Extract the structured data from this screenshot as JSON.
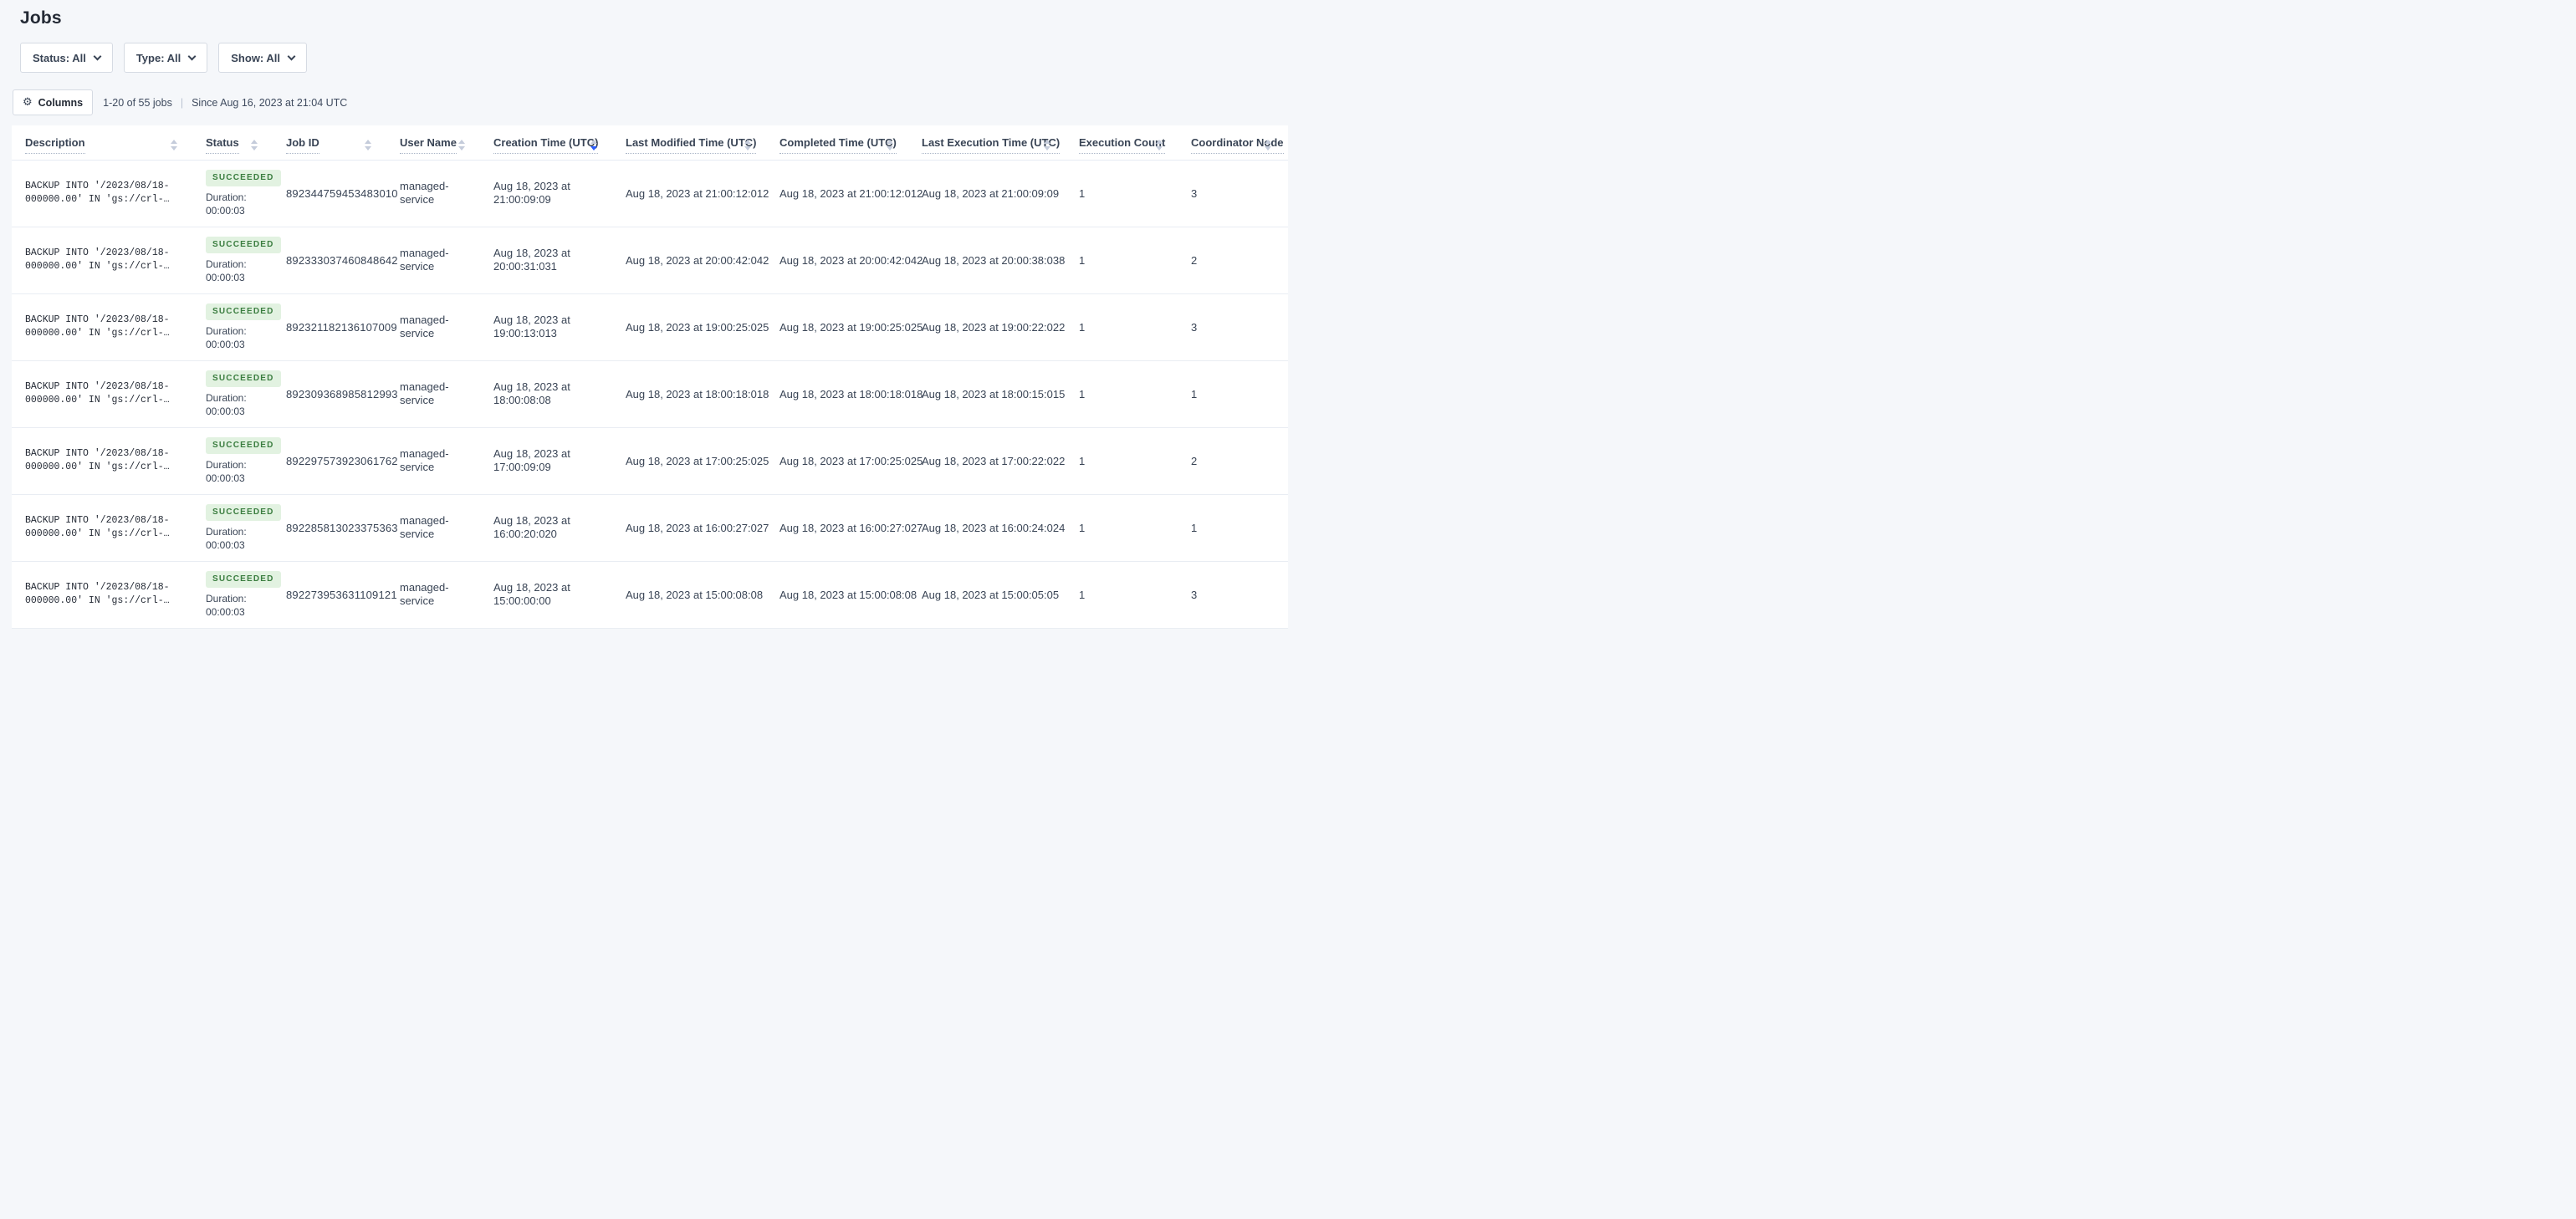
{
  "page": {
    "title": "Jobs"
  },
  "filters": [
    {
      "label": "Status: All"
    },
    {
      "label": "Type: All"
    },
    {
      "label": "Show: All"
    }
  ],
  "toolbar": {
    "columns_button": "Columns",
    "results_count": "1-20 of 55 jobs",
    "separator": "|",
    "since": "Since Aug 16, 2023 at 21:04 UTC"
  },
  "table": {
    "sort": {
      "column": "Creation Time (UTC)",
      "direction": "desc"
    },
    "columns": [
      {
        "label": "Description"
      },
      {
        "label": "Status"
      },
      {
        "label": "Job ID"
      },
      {
        "label": "User Name"
      },
      {
        "label": "Creation Time (UTC)"
      },
      {
        "label": "Last Modified Time (UTC)"
      },
      {
        "label": "Completed Time (UTC)"
      },
      {
        "label": "Last Execution Time (UTC)"
      },
      {
        "label": "Execution Count"
      },
      {
        "label": "Coordinator Node"
      }
    ],
    "labels": {
      "duration": "Duration:"
    },
    "jobs": [
      {
        "description_line1": "BACKUP INTO '/2023/08/18-",
        "description_line2": "000000.00' IN 'gs://crl-…",
        "status": "SUCCEEDED",
        "duration": "00:00:03",
        "job_id": "892344759453483010",
        "user_name": "managed-service",
        "creation_time": "Aug 18, 2023 at 21:00:09:09",
        "last_modified_time": "Aug 18, 2023 at 21:00:12:012",
        "completed_time": "Aug 18, 2023 at 21:00:12:012",
        "last_execution_time": "Aug 18, 2023 at 21:00:09:09",
        "execution_count": "1",
        "coordinator_node": "3"
      },
      {
        "description_line1": "BACKUP INTO '/2023/08/18-",
        "description_line2": "000000.00' IN 'gs://crl-…",
        "status": "SUCCEEDED",
        "duration": "00:00:03",
        "job_id": "892333037460848642",
        "user_name": "managed-service",
        "creation_time": "Aug 18, 2023 at 20:00:31:031",
        "last_modified_time": "Aug 18, 2023 at 20:00:42:042",
        "completed_time": "Aug 18, 2023 at 20:00:42:042",
        "last_execution_time": "Aug 18, 2023 at 20:00:38:038",
        "execution_count": "1",
        "coordinator_node": "2"
      },
      {
        "description_line1": "BACKUP INTO '/2023/08/18-",
        "description_line2": "000000.00' IN 'gs://crl-…",
        "status": "SUCCEEDED",
        "duration": "00:00:03",
        "job_id": "892321182136107009",
        "user_name": "managed-service",
        "creation_time": "Aug 18, 2023 at 19:00:13:013",
        "last_modified_time": "Aug 18, 2023 at 19:00:25:025",
        "completed_time": "Aug 18, 2023 at 19:00:25:025",
        "last_execution_time": "Aug 18, 2023 at 19:00:22:022",
        "execution_count": "1",
        "coordinator_node": "3"
      },
      {
        "description_line1": "BACKUP INTO '/2023/08/18-",
        "description_line2": "000000.00' IN 'gs://crl-…",
        "status": "SUCCEEDED",
        "duration": "00:00:03",
        "job_id": "892309368985812993",
        "user_name": "managed-service",
        "creation_time": "Aug 18, 2023 at 18:00:08:08",
        "last_modified_time": "Aug 18, 2023 at 18:00:18:018",
        "completed_time": "Aug 18, 2023 at 18:00:18:018",
        "last_execution_time": "Aug 18, 2023 at 18:00:15:015",
        "execution_count": "1",
        "coordinator_node": "1"
      },
      {
        "description_line1": "BACKUP INTO '/2023/08/18-",
        "description_line2": "000000.00' IN 'gs://crl-…",
        "status": "SUCCEEDED",
        "duration": "00:00:03",
        "job_id": "892297573923061762",
        "user_name": "managed-service",
        "creation_time": "Aug 18, 2023 at 17:00:09:09",
        "last_modified_time": "Aug 18, 2023 at 17:00:25:025",
        "completed_time": "Aug 18, 2023 at 17:00:25:025",
        "last_execution_time": "Aug 18, 2023 at 17:00:22:022",
        "execution_count": "1",
        "coordinator_node": "2"
      },
      {
        "description_line1": "BACKUP INTO '/2023/08/18-",
        "description_line2": "000000.00' IN 'gs://crl-…",
        "status": "SUCCEEDED",
        "duration": "00:00:03",
        "job_id": "892285813023375363",
        "user_name": "managed-service",
        "creation_time": "Aug 18, 2023 at 16:00:20:020",
        "last_modified_time": "Aug 18, 2023 at 16:00:27:027",
        "completed_time": "Aug 18, 2023 at 16:00:27:027",
        "last_execution_time": "Aug 18, 2023 at 16:00:24:024",
        "execution_count": "1",
        "coordinator_node": "1"
      },
      {
        "description_line1": "BACKUP INTO '/2023/08/18-",
        "description_line2": "000000.00' IN 'gs://crl-…",
        "status": "SUCCEEDED",
        "duration": "00:00:03",
        "job_id": "892273953631109121",
        "user_name": "managed-service",
        "creation_time": "Aug 18, 2023 at 15:00:00:00",
        "last_modified_time": "Aug 18, 2023 at 15:00:08:08",
        "completed_time": "Aug 18, 2023 at 15:00:08:08",
        "last_execution_time": "Aug 18, 2023 at 15:00:05:05",
        "execution_count": "1",
        "coordinator_node": "3"
      }
    ]
  },
  "colors": {
    "page_background": "#f5f7fa",
    "card_background": "#ffffff",
    "text_primary": "#394455",
    "status_succeeded_bg": "#e2f2e1",
    "status_succeeded_text": "#3a7d3f",
    "sort_active_arrow": "#2a5cff",
    "row_border": "#e9edf3"
  }
}
